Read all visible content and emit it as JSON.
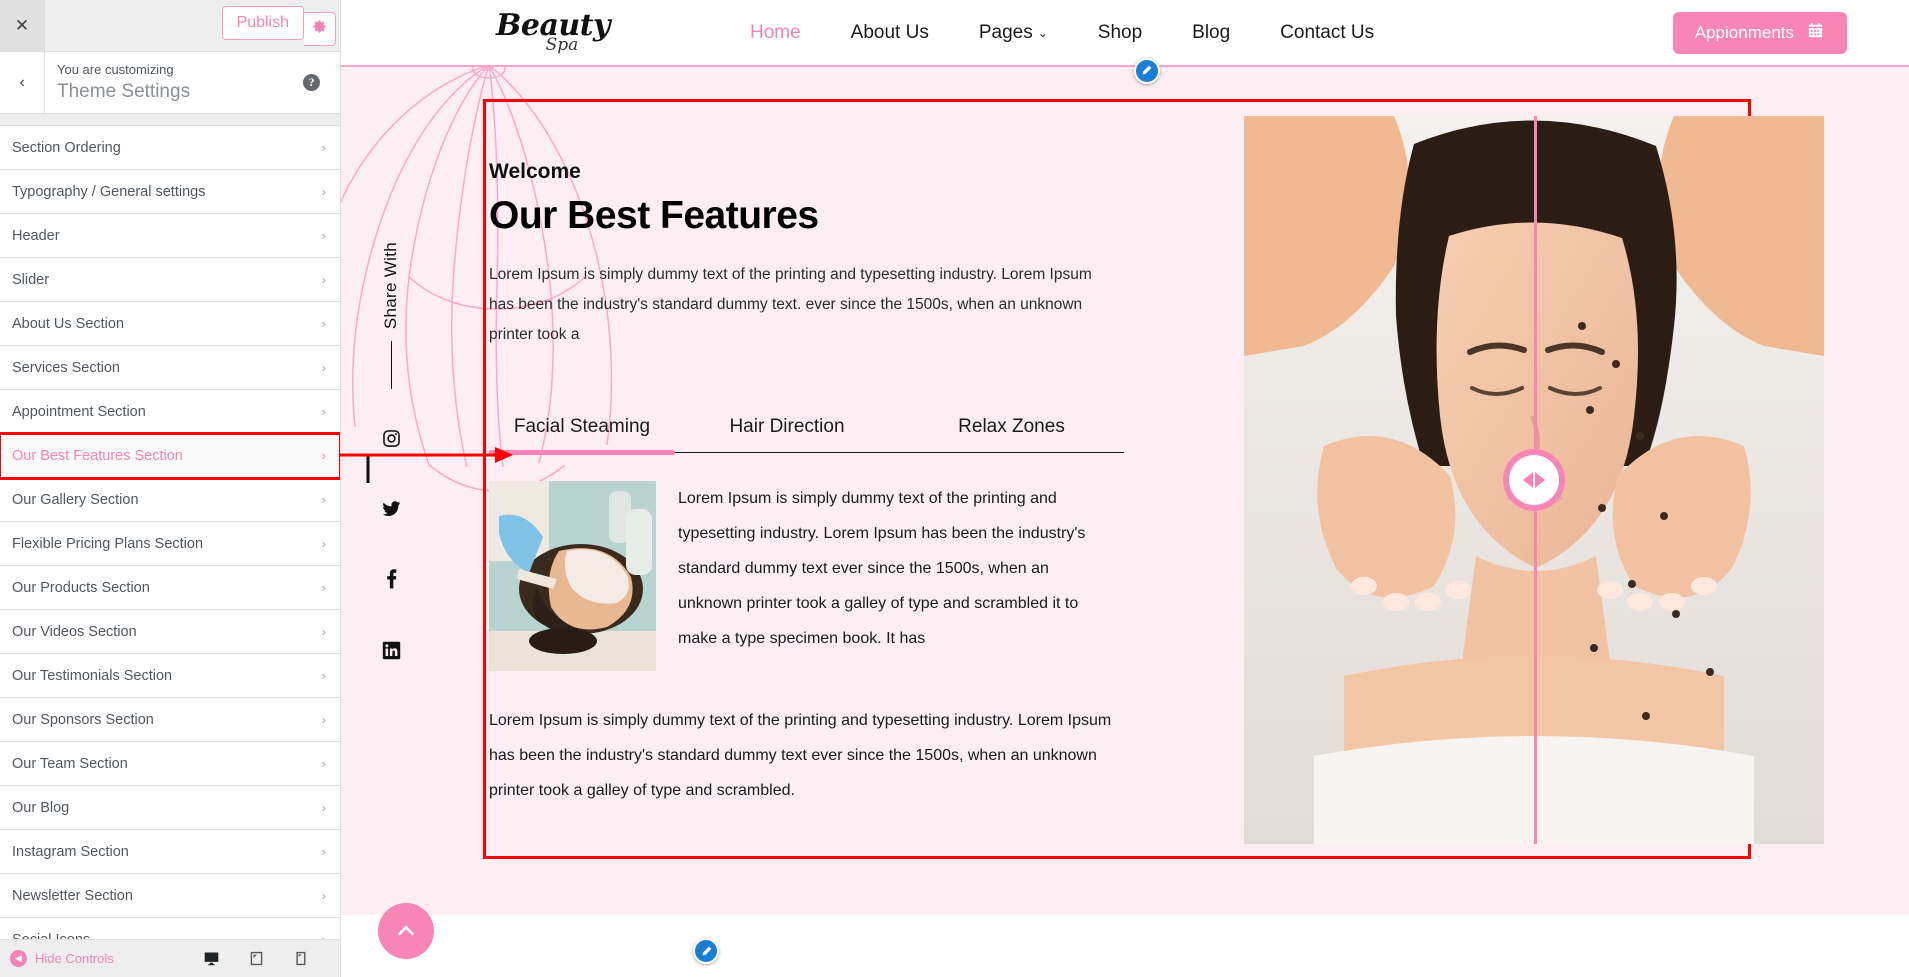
{
  "customizer": {
    "close_label": "✕",
    "publish_label": "Publish",
    "gear_icon": "gear-icon",
    "back_label": "‹",
    "subtitle": "You are customizing",
    "title": "Theme Settings",
    "help_label": "?",
    "items": [
      {
        "label": "Section Ordering",
        "chevron": "›",
        "state": "normal"
      },
      {
        "label": "Typography / General settings",
        "chevron": "›",
        "state": "normal"
      },
      {
        "label": "Header",
        "chevron": "›",
        "state": "normal"
      },
      {
        "label": "Slider",
        "chevron": "›",
        "state": "normal"
      },
      {
        "label": "About Us Section",
        "chevron": "›",
        "state": "normal"
      },
      {
        "label": "Services Section",
        "chevron": "›",
        "state": "normal"
      },
      {
        "label": "Appointment Section",
        "chevron": "›",
        "state": "normal"
      },
      {
        "label": "Our Best Features Section",
        "chevron": "›",
        "state": "highlighted"
      },
      {
        "label": "Our Gallery Section",
        "chevron": "›",
        "state": "normal"
      },
      {
        "label": "Flexible Pricing Plans Section",
        "chevron": "›",
        "state": "normal"
      },
      {
        "label": "Our Products Section",
        "chevron": "›",
        "state": "normal"
      },
      {
        "label": "Our Videos Section",
        "chevron": "›",
        "state": "normal"
      },
      {
        "label": "Our Testimonials Section",
        "chevron": "›",
        "state": "normal"
      },
      {
        "label": "Our Sponsors Section",
        "chevron": "›",
        "state": "normal"
      },
      {
        "label": "Our Team Section",
        "chevron": "›",
        "state": "normal"
      },
      {
        "label": "Our Blog",
        "chevron": "›",
        "state": "normal"
      },
      {
        "label": "Instagram Section",
        "chevron": "›",
        "state": "normal"
      },
      {
        "label": "Newsletter Section",
        "chevron": "›",
        "state": "normal"
      },
      {
        "label": "Social Icons",
        "chevron": "›",
        "state": "normal"
      }
    ],
    "footer": {
      "hide_controls_label": "Hide Controls",
      "devices": [
        {
          "name": "desktop-preview",
          "active": true
        },
        {
          "name": "tablet-preview",
          "active": false
        },
        {
          "name": "mobile-preview",
          "active": false
        }
      ]
    }
  },
  "site": {
    "logo": {
      "line1": "Beauty",
      "line2": "Spa"
    },
    "nav": [
      {
        "label": "Home",
        "current": true,
        "caret": ""
      },
      {
        "label": "About Us",
        "current": false,
        "caret": ""
      },
      {
        "label": "Pages",
        "current": false,
        "caret": "⌄"
      },
      {
        "label": "Shop",
        "current": false,
        "caret": ""
      },
      {
        "label": "Blog",
        "current": false,
        "caret": ""
      },
      {
        "label": "Contact Us",
        "current": false,
        "caret": ""
      }
    ],
    "appointment_button": "Appionments",
    "share": {
      "label": "Share With",
      "icons": [
        "instagram-icon",
        "twitter-icon",
        "facebook-icon",
        "linkedin-icon"
      ]
    },
    "features": {
      "eyebrow": "Welcome",
      "heading": "Our Best Features",
      "intro": "Lorem Ipsum is simply dummy text of the printing and typesetting industry. Lorem Ipsum has been the industry's standard dummy text. ever since the 1500s, when an unknown printer took a",
      "tabs": [
        {
          "label": "Facial Steaming",
          "active": true
        },
        {
          "label": "Hair Direction",
          "active": false
        },
        {
          "label": "Relax Zones",
          "active": false
        }
      ],
      "tab_body": "Lorem Ipsum is simply dummy text of the printing and typesetting industry. Lorem Ipsum has been the industry's standard dummy text ever since the 1500s, when an unknown printer took a galley of type and scrambled it to make a type specimen book. It has",
      "footer_text": "Lorem Ipsum is simply dummy text of the printing and typesetting industry. Lorem Ipsum has been the industry's standard dummy text ever since the 1500s, when an unknown printer took a galley of type and scrambled."
    }
  },
  "colors": {
    "accent_pink": "#f785b5",
    "soft_pink_bg": "#fdeef4",
    "highlight_red": "#ff0000",
    "edit_pin_blue": "#1a7fd4"
  }
}
